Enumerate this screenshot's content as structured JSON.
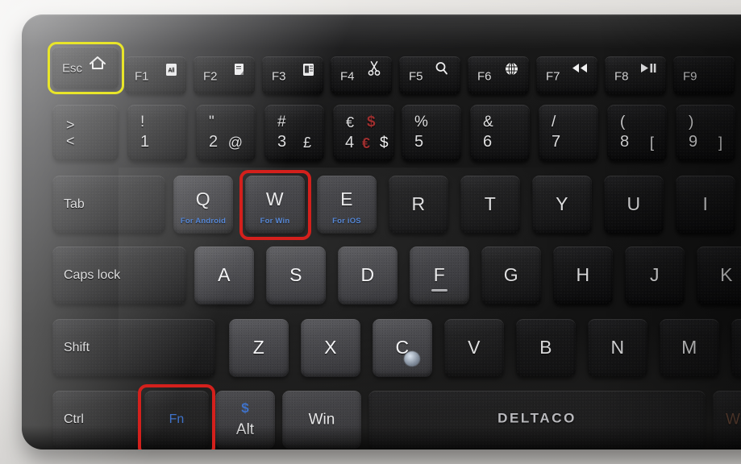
{
  "scene": {
    "subject": "deltaco-bluetooth-keyboard",
    "background_color": "#e6e4e1",
    "chassis_color": "#141414"
  },
  "brand": {
    "name": "DELTACO"
  },
  "annotations": {
    "esc_highlight": {
      "color": "#e8e52a",
      "shape": "rectangle",
      "target": "esc-key"
    },
    "w_highlight": {
      "color": "#d4201c",
      "shape": "rectangle",
      "target": "w-key"
    },
    "fn_highlight": {
      "color": "#d4201c",
      "shape": "rectangle",
      "target": "fn-key"
    }
  },
  "rows": {
    "function_row": [
      {
        "id": "esc",
        "label": "Esc",
        "icon": "home-icon"
      },
      {
        "id": "f1",
        "label": "F1",
        "icon": "select-all-icon"
      },
      {
        "id": "f2",
        "label": "F2",
        "icon": "copy-icon"
      },
      {
        "id": "f3",
        "label": "F3",
        "icon": "paste-icon"
      },
      {
        "id": "f4",
        "label": "F4",
        "icon": "scissors-icon"
      },
      {
        "id": "f5",
        "label": "F5",
        "icon": "search-icon"
      },
      {
        "id": "f6",
        "label": "F6",
        "icon": "globe-icon"
      },
      {
        "id": "f7",
        "label": "F7",
        "icon": "rewind-icon"
      },
      {
        "id": "f8",
        "label": "F8",
        "icon": "play-pause-icon"
      },
      {
        "id": "f9",
        "label": "F9",
        "icon": ""
      }
    ],
    "number_row": [
      {
        "id": "angle",
        "top": ">",
        "bottom": "<"
      },
      {
        "id": "one",
        "top": "!",
        "bottom": "1"
      },
      {
        "id": "two",
        "top": "\"",
        "bottom": "2",
        "alt": "@"
      },
      {
        "id": "three",
        "top": "#",
        "bottom": "3",
        "alt": "£"
      },
      {
        "id": "four",
        "top_eur": "€",
        "top_usd": "$",
        "bottom": "4",
        "alt_eur": "€",
        "alt_usd": "$"
      },
      {
        "id": "five",
        "top": "%",
        "bottom": "5"
      },
      {
        "id": "six",
        "top": "&",
        "bottom": "6"
      },
      {
        "id": "seven",
        "top": "/",
        "bottom": "7"
      },
      {
        "id": "eight",
        "top": "(",
        "bottom": "8",
        "alt": "["
      },
      {
        "id": "nine",
        "top": ")",
        "bottom": "9",
        "alt": "]"
      }
    ],
    "tab_row": [
      {
        "id": "tab",
        "label": "Tab"
      },
      {
        "id": "q",
        "label": "Q",
        "sub": "For Android"
      },
      {
        "id": "w",
        "label": "W",
        "sub": "For Win"
      },
      {
        "id": "e",
        "label": "E",
        "sub": "For iOS"
      },
      {
        "id": "r",
        "label": "R"
      },
      {
        "id": "t",
        "label": "T"
      },
      {
        "id": "y",
        "label": "Y"
      },
      {
        "id": "u",
        "label": "U"
      },
      {
        "id": "i",
        "label": "I"
      }
    ],
    "caps_row": [
      {
        "id": "caps",
        "label": "Caps lock"
      },
      {
        "id": "a",
        "label": "A"
      },
      {
        "id": "s",
        "label": "S"
      },
      {
        "id": "d",
        "label": "D"
      },
      {
        "id": "f",
        "label": "F"
      },
      {
        "id": "g",
        "label": "G"
      },
      {
        "id": "h",
        "label": "H"
      },
      {
        "id": "j",
        "label": "J"
      },
      {
        "id": "k",
        "label": "K"
      }
    ],
    "shift_row": [
      {
        "id": "shift",
        "label": "Shift"
      },
      {
        "id": "z",
        "label": "Z"
      },
      {
        "id": "x",
        "label": "X"
      },
      {
        "id": "c",
        "label": "C"
      },
      {
        "id": "v",
        "label": "V"
      },
      {
        "id": "b",
        "label": "B"
      },
      {
        "id": "n",
        "label": "N"
      },
      {
        "id": "m",
        "label": "M"
      },
      {
        "id": "semicolon",
        "top": ";",
        "bottom": ","
      }
    ],
    "bottom_row": [
      {
        "id": "ctrl",
        "label": "Ctrl"
      },
      {
        "id": "fn",
        "label": "Fn"
      },
      {
        "id": "alt",
        "label": "Alt",
        "alt": "$"
      },
      {
        "id": "win",
        "label": "Win"
      },
      {
        "id": "space",
        "label": ""
      },
      {
        "id": "right-partial",
        "label": "W"
      }
    ]
  }
}
